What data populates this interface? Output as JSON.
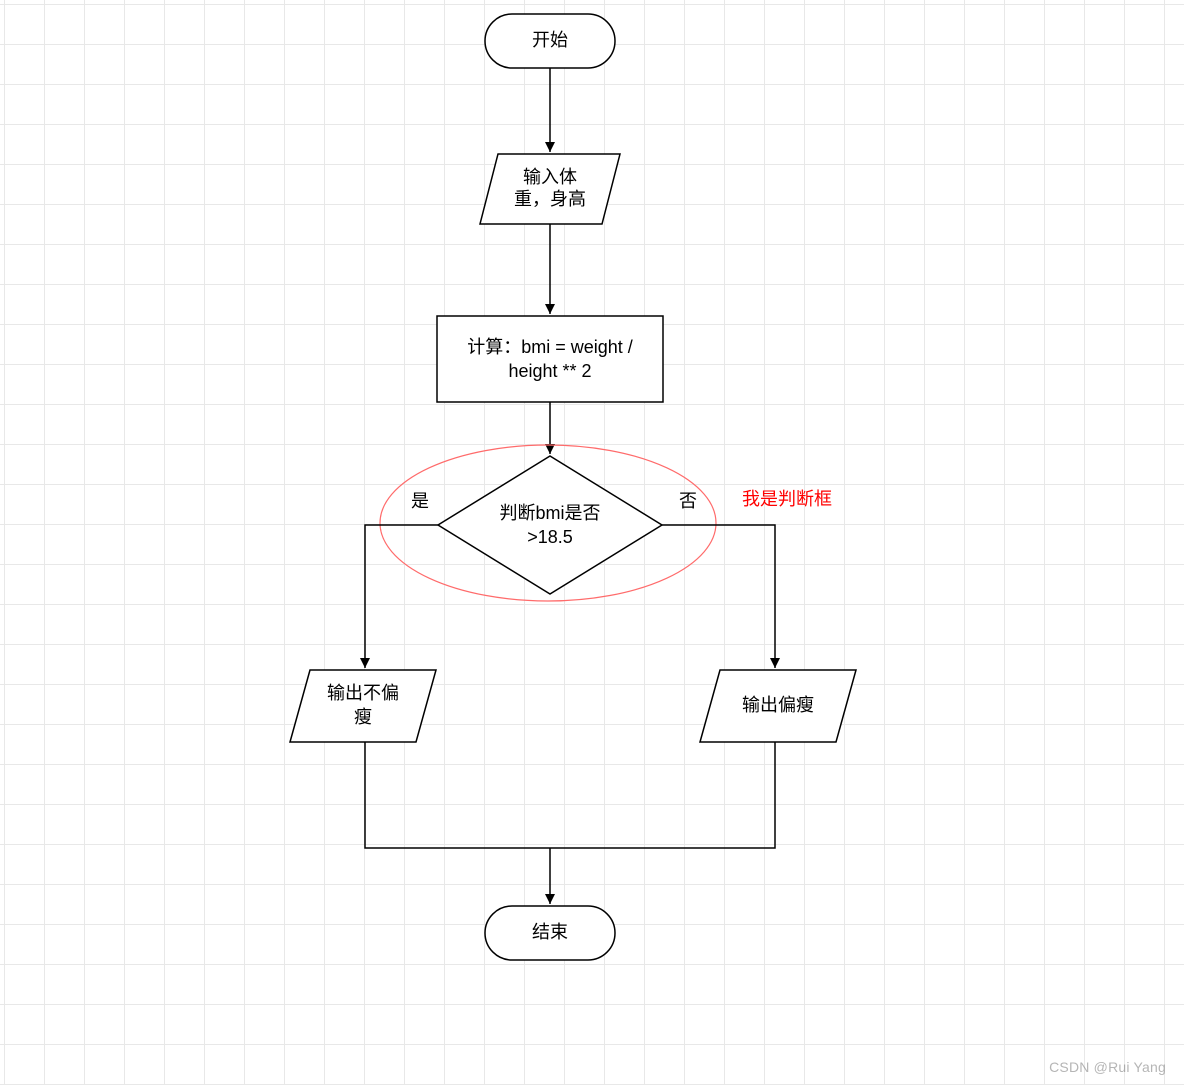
{
  "nodes": {
    "start": {
      "label": "开始"
    },
    "input": {
      "line1": "输入体",
      "line2": "重，身高"
    },
    "process": {
      "line1": "计算：bmi = weight /",
      "line2": "height ** 2"
    },
    "decision": {
      "line1": "判断bmi是否",
      "line2": ">18.5"
    },
    "out_no_thin": {
      "line1": "输出不偏",
      "line2": "瘦"
    },
    "out_thin": {
      "label": "输出偏瘦"
    },
    "end": {
      "label": "结束"
    }
  },
  "edges": {
    "yes": "是",
    "no": "否"
  },
  "annotation": "我是判断框",
  "watermark": "CSDN @Rui Yang"
}
